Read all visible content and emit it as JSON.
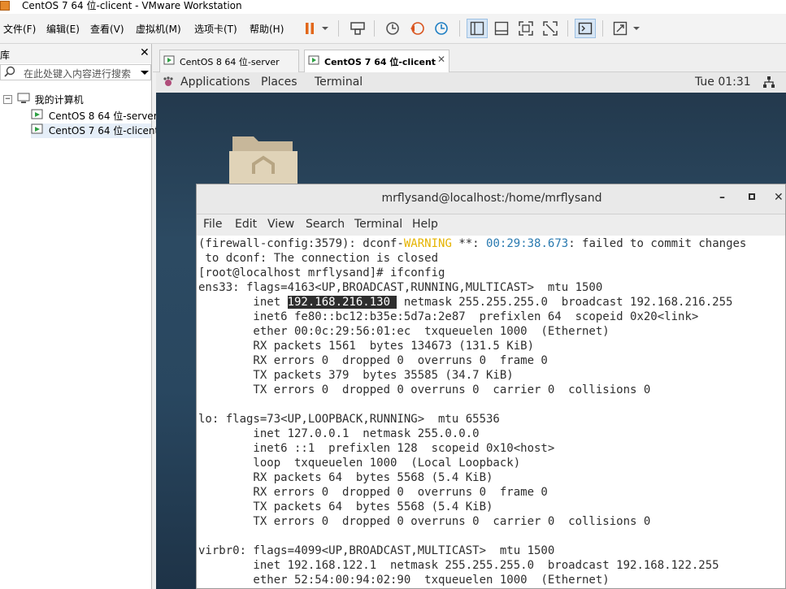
{
  "window": {
    "title": "CentOS 7 64 位-clicent - VMware Workstation"
  },
  "menubar": {
    "items": [
      "文件(F)",
      "编辑(E)",
      "查看(V)",
      "虚拟机(M)",
      "选项卡(T)",
      "帮助(H)"
    ]
  },
  "toolbar": {
    "icons": [
      "pause-icon",
      "dropdown-icon",
      "send-ctrl-alt-del-icon",
      "snapshot-icon",
      "revert-snapshot-icon",
      "snapshot-manager-icon",
      "library-view-icon",
      "thumbnail-bar-icon",
      "fullscreen-icon",
      "unity-icon",
      "console-view-icon",
      "stretch-icon"
    ]
  },
  "library": {
    "title": "库",
    "search_placeholder": "在此处键入内容进行搜索",
    "root": "我的计算机",
    "vms": [
      "CentOS 8 64 位-server",
      "CentOS 7 64 位-clicent"
    ]
  },
  "tabs": [
    {
      "label": "CentOS 8 64 位-server",
      "active": false
    },
    {
      "label": "CentOS 7 64 位-clicent",
      "active": true
    }
  ],
  "gnome": {
    "applications": "Applications",
    "places": "Places",
    "terminal": "Terminal",
    "clock": "Tue 01:31"
  },
  "terminal": {
    "title": "mrflysand@localhost:/home/mrflysand",
    "menu": [
      "File",
      "Edit",
      "View",
      "Search",
      "Terminal",
      "Help"
    ],
    "line1_a": "(firewall-config:3579): dconf-",
    "line1_warn": "WARNING",
    "line1_b": " **: ",
    "line1_time": "00:29:38.673",
    "line1_c": ": failed to commit changes",
    "lines_a": [
      " to dconf: The connection is closed",
      "[root@localhost mrflysand]# ifconfig",
      "ens33: flags=4163<UP,BROADCAST,RUNNING,MULTICAST>  mtu 1500"
    ],
    "inet_prefix": "        inet ",
    "inet_ip": "192.168.216.130 ",
    "inet_suffix": " netmask 255.255.255.0  broadcast 192.168.216.255",
    "lines_b": [
      "        inet6 fe80::bc12:b35e:5d7a:2e87  prefixlen 64  scopeid 0x20<link>",
      "        ether 00:0c:29:56:01:ec  txqueuelen 1000  (Ethernet)",
      "        RX packets 1561  bytes 134673 (131.5 KiB)",
      "        RX errors 0  dropped 0  overruns 0  frame 0",
      "        TX packets 379  bytes 35585 (34.7 KiB)",
      "        TX errors 0  dropped 0 overruns 0  carrier 0  collisions 0",
      "",
      "lo: flags=73<UP,LOOPBACK,RUNNING>  mtu 65536",
      "        inet 127.0.0.1  netmask 255.0.0.0",
      "        inet6 ::1  prefixlen 128  scopeid 0x10<host>",
      "        loop  txqueuelen 1000  (Local Loopback)",
      "        RX packets 64  bytes 5568 (5.4 KiB)",
      "        RX errors 0  dropped 0  overruns 0  frame 0",
      "        TX packets 64  bytes 5568 (5.4 KiB)",
      "        TX errors 0  dropped 0 overruns 0  carrier 0  collisions 0",
      "",
      "virbr0: flags=4099<UP,BROADCAST,MULTICAST>  mtu 1500",
      "        inet 192.168.122.1  netmask 255.255.255.0  broadcast 192.168.122.255",
      "        ether 52:54:00:94:02:90  txqueuelen 1000  (Ethernet)"
    ]
  }
}
